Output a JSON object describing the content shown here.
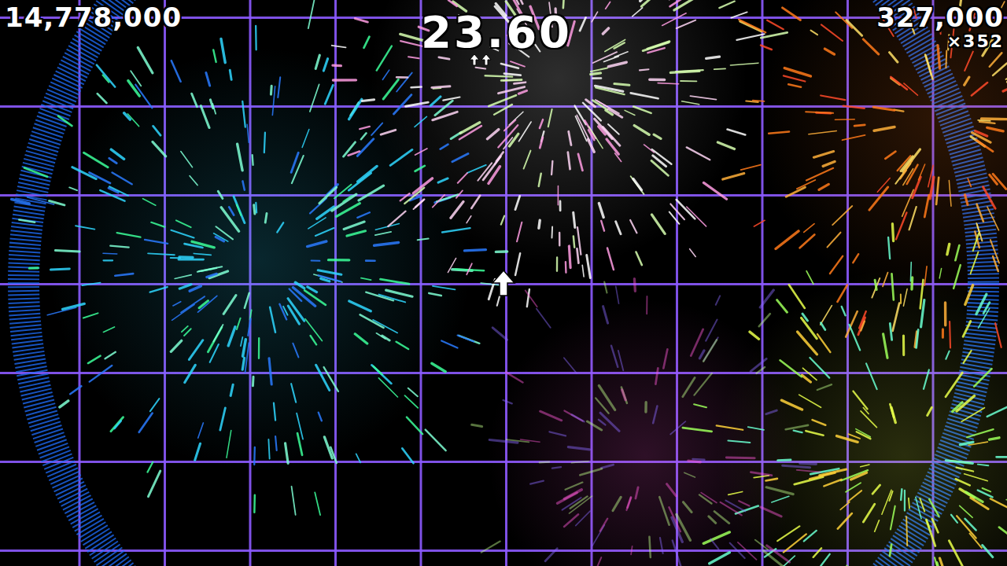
{
  "hud": {
    "score": "14,778,000",
    "time": "23.60",
    "combo_score": "327,000",
    "multiplier": "×352"
  },
  "speed_arrows": 2,
  "player": {
    "direction": "up"
  }
}
